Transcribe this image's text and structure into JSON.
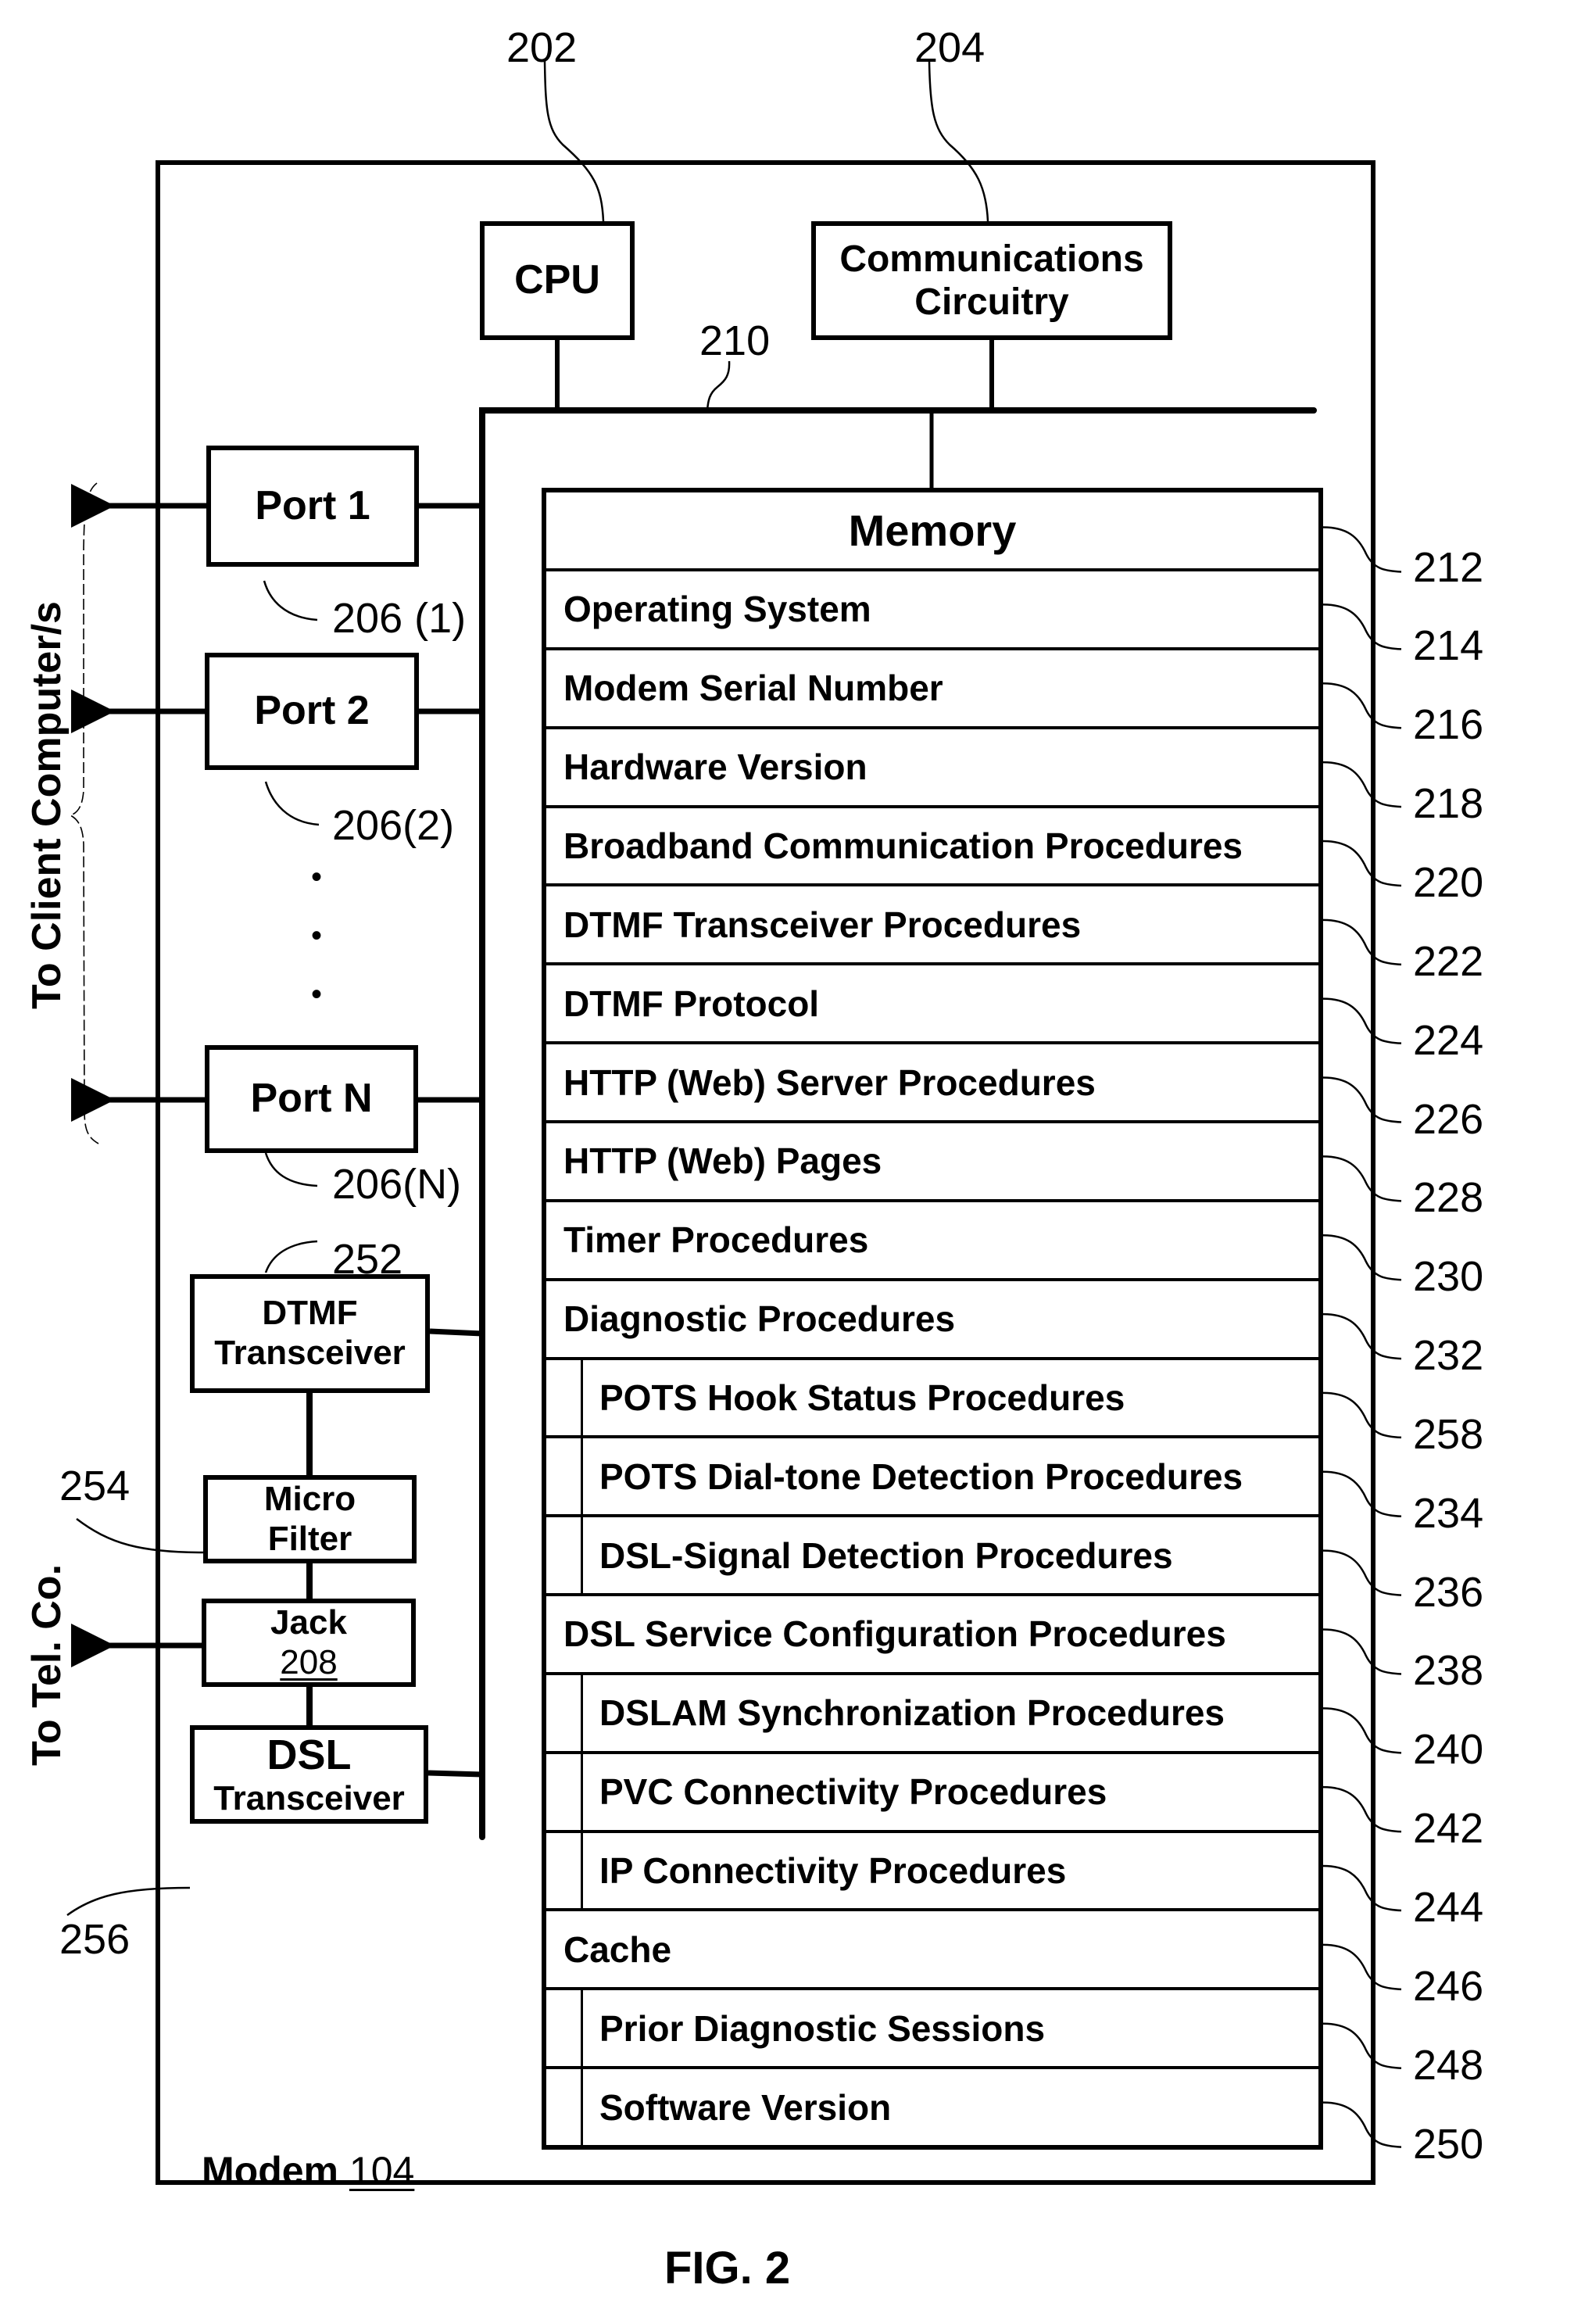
{
  "figure": {
    "caption": "FIG. 2",
    "device_label": "Modem",
    "device_ref": "104",
    "bus_ref": "210"
  },
  "top_components": [
    {
      "id": "cpu",
      "label": "CPU",
      "ref": "202"
    },
    {
      "id": "comm",
      "label": "Communications Circuitry",
      "label_lines": [
        "Communications",
        "Circuitry"
      ],
      "ref": "204"
    }
  ],
  "ports": [
    {
      "label": "Port 1",
      "ref": "206 (1)"
    },
    {
      "label": "Port 2",
      "ref": "206(2)"
    },
    {
      "label": "Port N",
      "ref": "206(N)"
    }
  ],
  "ellipsis": "•",
  "line_components": [
    {
      "id": "dtmf",
      "label_lines": [
        "DTMF",
        "Transceiver"
      ],
      "ref": "252"
    },
    {
      "id": "microfilter",
      "label_lines": [
        "Micro",
        "Filter"
      ],
      "ref": "254"
    },
    {
      "id": "jack",
      "label_lines": [
        "Jack"
      ],
      "ref": "208"
    },
    {
      "id": "dsl",
      "label_lines": [
        "DSL",
        "Transceiver"
      ],
      "ref": "256"
    }
  ],
  "side_labels": {
    "clients": "To Client Computer/s",
    "telco": "To Tel. Co."
  },
  "memory": {
    "title": "Memory",
    "ref": "212",
    "rows": [
      {
        "label": "Operating System",
        "ref": "214",
        "indent": false
      },
      {
        "label": "Modem Serial Number",
        "ref": "216",
        "indent": false
      },
      {
        "label": "Hardware Version",
        "ref": "218",
        "indent": false
      },
      {
        "label": "Broadband Communication Procedures",
        "ref": "220",
        "indent": false
      },
      {
        "label": "DTMF Transceiver Procedures",
        "ref": "222",
        "indent": false
      },
      {
        "label": "DTMF Protocol",
        "ref": "224",
        "indent": false
      },
      {
        "label": "HTTP (Web) Server Procedures",
        "ref": "226",
        "indent": false
      },
      {
        "label": "HTTP (Web) Pages",
        "ref": "228",
        "indent": false
      },
      {
        "label": "Timer Procedures",
        "ref": "230",
        "indent": false
      },
      {
        "label": "Diagnostic Procedures",
        "ref": "232",
        "indent": false
      },
      {
        "label": "POTS Hook Status Procedures",
        "ref": "258",
        "indent": true
      },
      {
        "label": "POTS Dial-tone Detection Procedures",
        "ref": "234",
        "indent": true
      },
      {
        "label": "DSL-Signal Detection Procedures",
        "ref": "236",
        "indent": true
      },
      {
        "label": "DSL Service Configuration Procedures",
        "ref": "238",
        "indent": false
      },
      {
        "label": "DSLAM Synchronization Procedures",
        "ref": "240",
        "indent": true
      },
      {
        "label": "PVC Connectivity Procedures",
        "ref": "242",
        "indent": true
      },
      {
        "label": "IP Connectivity Procedures",
        "ref": "244",
        "indent": true
      },
      {
        "label": "Cache",
        "ref": "246",
        "indent": false
      },
      {
        "label": "Prior Diagnostic Sessions",
        "ref": "248",
        "indent": true
      },
      {
        "label": "Software Version",
        "ref": "250",
        "indent": true
      }
    ]
  }
}
